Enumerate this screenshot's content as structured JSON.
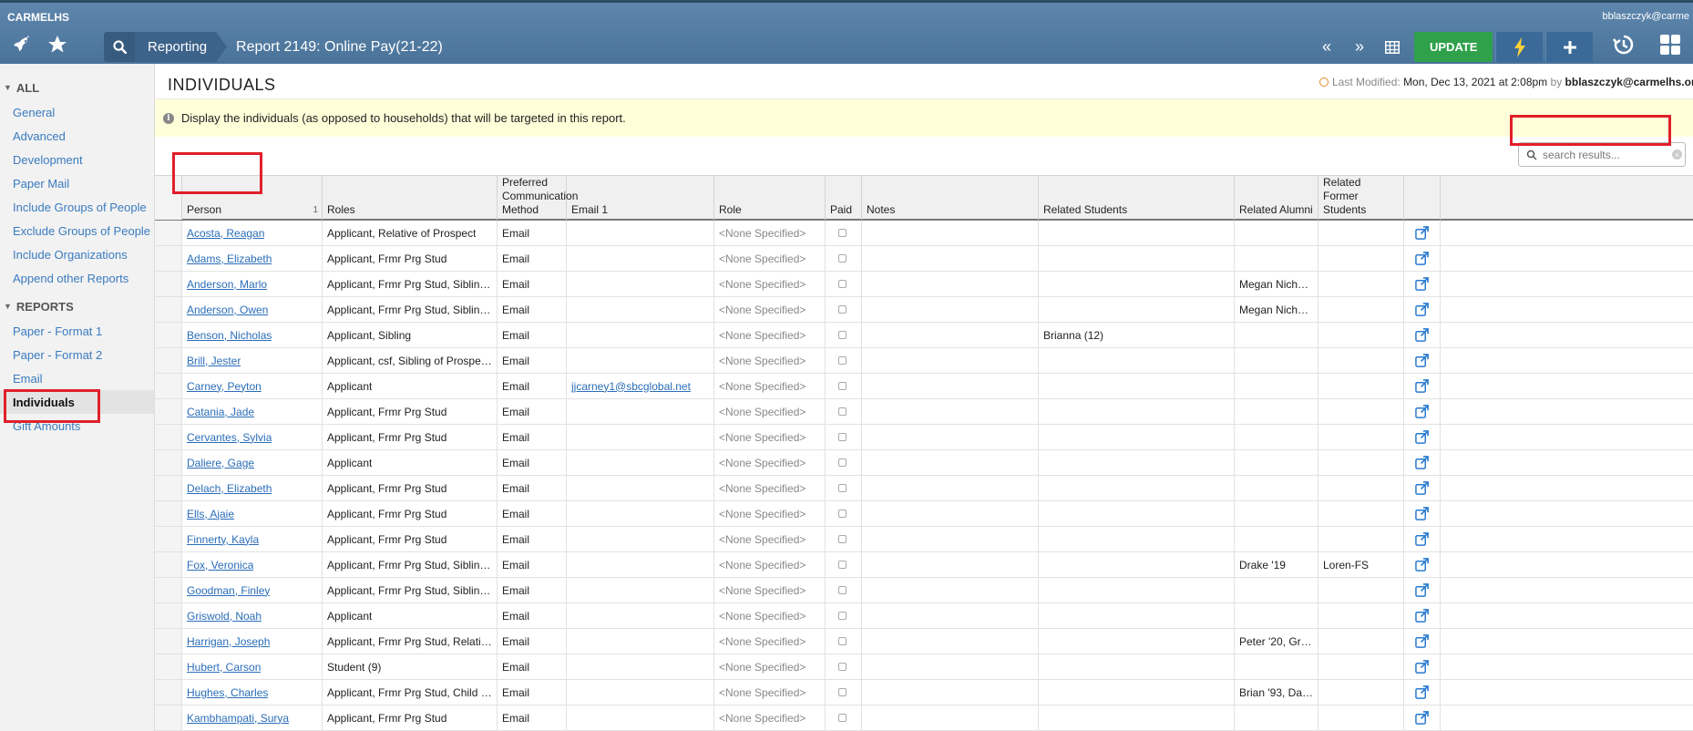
{
  "app": {
    "name": "CARMELHS",
    "user": "bblaszczyk@carme"
  },
  "breadcrumb": {
    "module": "Reporting",
    "report_title": "Report 2149: Online Pay(21-22)"
  },
  "toolbar": {
    "update_label": "UPDATE"
  },
  "sidebar": {
    "sections": [
      {
        "label": "ALL",
        "items": [
          "General",
          "Advanced",
          "Development",
          "Paper Mail",
          "Include Groups of People",
          "Exclude Groups of People",
          "Include Organizations",
          "Append other Reports"
        ]
      },
      {
        "label": "REPORTS",
        "items": [
          "Paper - Format 1",
          "Paper - Format 2",
          "Email",
          "Individuals",
          "Gift Amounts"
        ]
      }
    ],
    "active_item": "Individuals"
  },
  "page": {
    "title": "INDIVIDUALS",
    "last_modified_label": "Last Modified:",
    "last_modified_date": "Mon, Dec 13, 2021 at 2:08pm",
    "by_label": "by",
    "modified_by": "bblaszczyk@carmelhs.org",
    "info_text": "Display the individuals (as opposed to households) that will be targeted in this report.",
    "search_placeholder": "search results..."
  },
  "table": {
    "columns": [
      "",
      "Person",
      "Roles",
      "Preferred Communication Method",
      "Email 1",
      "Role",
      "Paid",
      "Notes",
      "Related Students",
      "Related Alumni",
      "Related Former Students",
      "",
      ""
    ],
    "sort_indicator": "1",
    "rows": [
      {
        "person": "Acosta, Reagan",
        "roles": "Applicant, Relative of Prospect",
        "method": "Email",
        "email": "",
        "role": "<None Specified>",
        "notes": "",
        "students": "",
        "alumni": "",
        "former": ""
      },
      {
        "person": "Adams, Elizabeth",
        "roles": "Applicant, Frmr Prg Stud",
        "method": "Email",
        "email": "",
        "role": "<None Specified>",
        "notes": "",
        "students": "",
        "alumni": "",
        "former": ""
      },
      {
        "person": "Anderson, Marlo",
        "roles": "Applicant, Frmr Prg Stud, Siblin…",
        "method": "Email",
        "email": "",
        "role": "<None Specified>",
        "notes": "",
        "students": "",
        "alumni": "Megan Nicho…",
        "former": ""
      },
      {
        "person": "Anderson, Owen",
        "roles": "Applicant, Frmr Prg Stud, Siblin…",
        "method": "Email",
        "email": "",
        "role": "<None Specified>",
        "notes": "",
        "students": "",
        "alumni": "Megan Nicho…",
        "former": ""
      },
      {
        "person": "Benson, Nicholas",
        "roles": "Applicant, Sibling",
        "method": "Email",
        "email": "",
        "role": "<None Specified>",
        "notes": "",
        "students": "Brianna (12)",
        "alumni": "",
        "former": ""
      },
      {
        "person": "Brill, Jester",
        "roles": "Applicant, csf, Sibling of Prospec…",
        "method": "Email",
        "email": "",
        "role": "<None Specified>",
        "notes": "",
        "students": "",
        "alumni": "",
        "former": ""
      },
      {
        "person": "Carney, Peyton",
        "roles": "Applicant",
        "method": "Email",
        "email": "jjcarney1@sbcglobal.net",
        "role": "<None Specified>",
        "notes": "",
        "students": "",
        "alumni": "",
        "former": ""
      },
      {
        "person": "Catania, Jade",
        "roles": "Applicant, Frmr Prg Stud",
        "method": "Email",
        "email": "",
        "role": "<None Specified>",
        "notes": "",
        "students": "",
        "alumni": "",
        "former": ""
      },
      {
        "person": "Cervantes, Sylvia",
        "roles": "Applicant, Frmr Prg Stud",
        "method": "Email",
        "email": "",
        "role": "<None Specified>",
        "notes": "",
        "students": "",
        "alumni": "",
        "former": ""
      },
      {
        "person": "Daliere, Gage",
        "roles": "Applicant",
        "method": "Email",
        "email": "",
        "role": "<None Specified>",
        "notes": "",
        "students": "",
        "alumni": "",
        "former": ""
      },
      {
        "person": "Delach, Elizabeth",
        "roles": "Applicant, Frmr Prg Stud",
        "method": "Email",
        "email": "",
        "role": "<None Specified>",
        "notes": "",
        "students": "",
        "alumni": "",
        "former": ""
      },
      {
        "person": "Ells, Ajaie",
        "roles": "Applicant, Frmr Prg Stud",
        "method": "Email",
        "email": "",
        "role": "<None Specified>",
        "notes": "",
        "students": "",
        "alumni": "",
        "former": ""
      },
      {
        "person": "Finnerty, Kayla",
        "roles": "Applicant, Frmr Prg Stud",
        "method": "Email",
        "email": "",
        "role": "<None Specified>",
        "notes": "",
        "students": "",
        "alumni": "",
        "former": ""
      },
      {
        "person": "Fox, Veronica",
        "roles": "Applicant, Frmr Prg Stud, Siblin…",
        "method": "Email",
        "email": "",
        "role": "<None Specified>",
        "notes": "",
        "students": "",
        "alumni": "Drake '19",
        "former": "Loren-FS"
      },
      {
        "person": "Goodman, Finley",
        "roles": "Applicant, Frmr Prg Stud, Siblin…",
        "method": "Email",
        "email": "",
        "role": "<None Specified>",
        "notes": "",
        "students": "",
        "alumni": "",
        "former": ""
      },
      {
        "person": "Griswold, Noah",
        "roles": "Applicant",
        "method": "Email",
        "email": "",
        "role": "<None Specified>",
        "notes": "",
        "students": "",
        "alumni": "",
        "former": ""
      },
      {
        "person": "Harrigan, Joseph",
        "roles": "Applicant, Frmr Prg Stud, Relativ…",
        "method": "Email",
        "email": "",
        "role": "<None Specified>",
        "notes": "",
        "students": "",
        "alumni": "Peter '20, Gra…",
        "former": ""
      },
      {
        "person": "Hubert, Carson",
        "roles": "Student (9)",
        "method": "Email",
        "email": "",
        "role": "<None Specified>",
        "notes": "",
        "students": "",
        "alumni": "",
        "former": ""
      },
      {
        "person": "Hughes, Charles",
        "roles": "Applicant, Frmr Prg Stud, Child …",
        "method": "Email",
        "email": "",
        "role": "<None Specified>",
        "notes": "",
        "students": "",
        "alumni": "Brian '93, Da…",
        "former": ""
      },
      {
        "person": "Kambhampati, Surya",
        "roles": "Applicant, Frmr Prg Stud",
        "method": "Email",
        "email": "",
        "role": "<None Specified>",
        "notes": "",
        "students": "",
        "alumni": "",
        "former": ""
      }
    ]
  },
  "colors": {
    "topbar": "#4f789f",
    "update": "#2fa14b",
    "link": "#2a6db8",
    "highlight": "#e0202a",
    "info_bg": "#ffffd9"
  }
}
